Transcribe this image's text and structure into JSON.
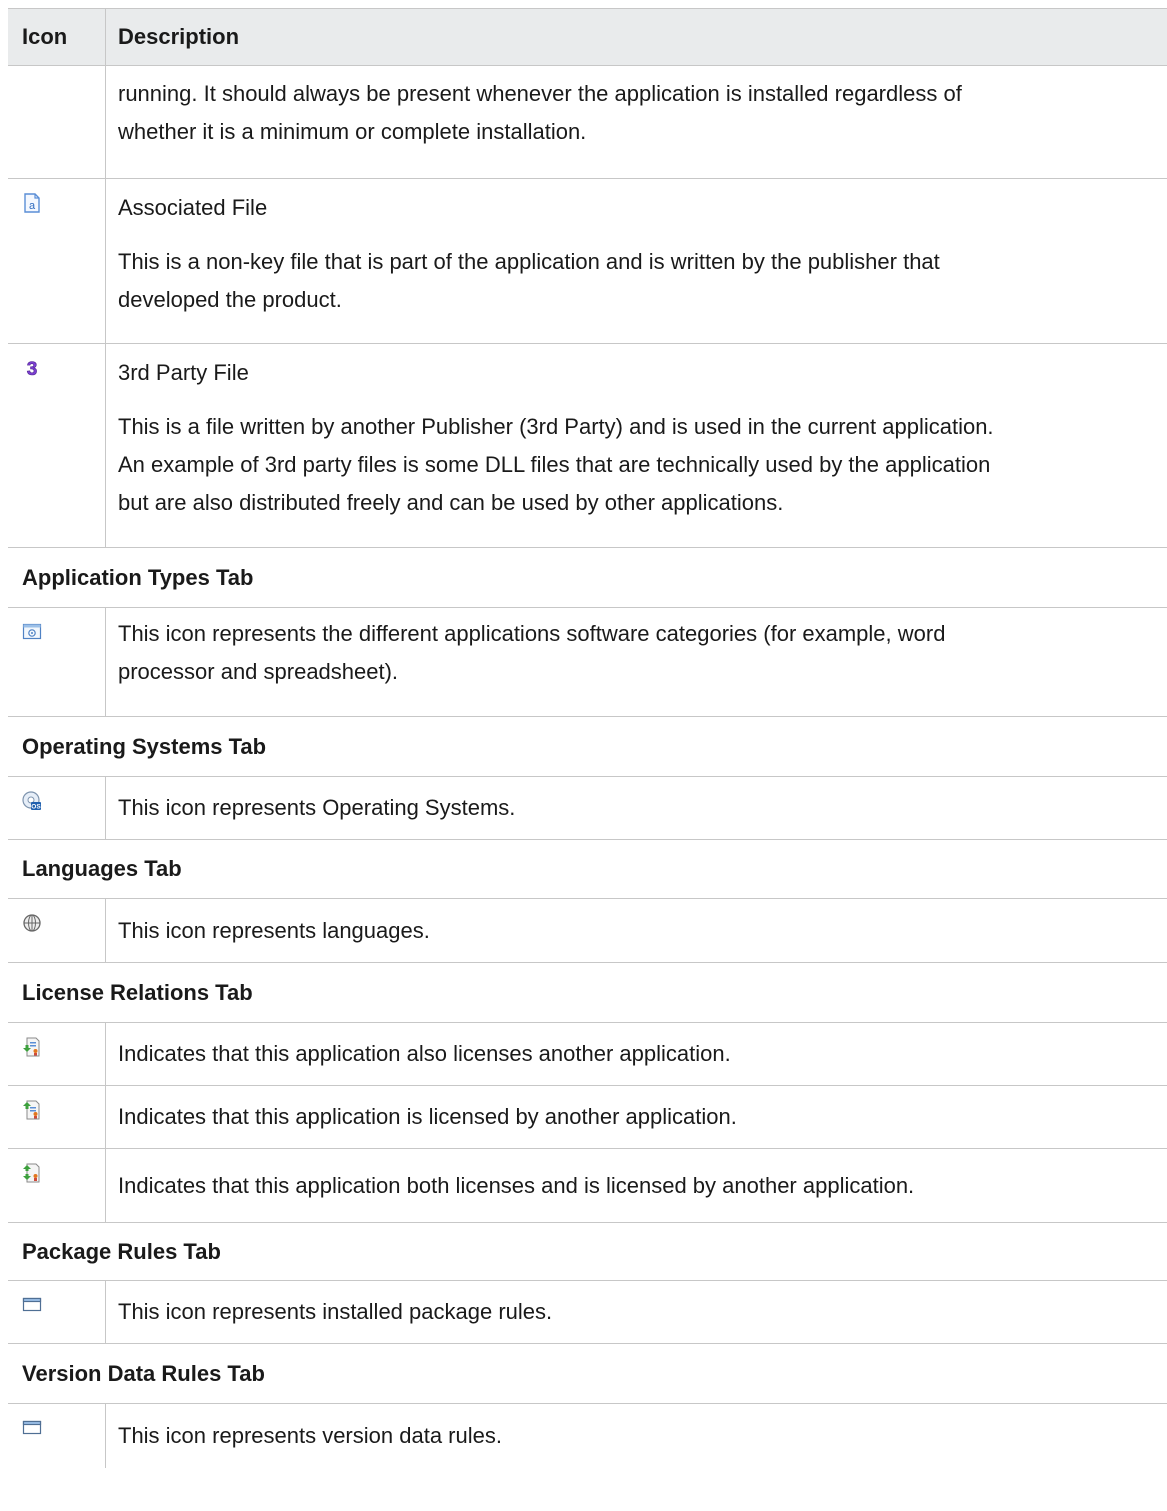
{
  "header": {
    "icon_col": "Icon",
    "desc_col": "Description"
  },
  "rows": [
    {
      "icon": "",
      "paras": [
        "running. It should always be present whenever the application is installed regardless of",
        "whether it is a minimum or complete installation."
      ]
    },
    {
      "icon": "associated-file-icon",
      "title": "Associated File",
      "paras": [
        "This is a non-key file that is part of the application and is written by the publisher that",
        "developed the product."
      ]
    },
    {
      "icon": "third-party-file-icon",
      "title": "3rd Party File",
      "paras": [
        "This is a file written by another Publisher (3rd Party) and is used in the current application.",
        "An example of 3rd party files is some DLL files that are technically used by the application",
        "but are also distributed freely and can be used by other applications."
      ]
    }
  ],
  "sections": {
    "app_types": {
      "title": "Application Types Tab",
      "line1": "This icon represents the different applications software categories (for example, word",
      "line2": "processor and spreadsheet)."
    },
    "os": {
      "title": "Operating Systems Tab",
      "text": "This icon represents Operating Systems."
    },
    "languages": {
      "title": "Languages Tab",
      "text": "This icon represents languages."
    },
    "license": {
      "title": "License Relations Tab",
      "t1": "Indicates that this application also licenses another application.",
      "t2": "Indicates that this application is licensed by another application.",
      "t3": "Indicates that this application both licenses and is licensed by another application."
    },
    "package": {
      "title": "Package Rules Tab",
      "text": "This icon represents installed package rules."
    },
    "version": {
      "title": "Version Data Rules Tab",
      "text": "This icon represents version data rules."
    }
  },
  "colors": {
    "border": "#c7c7c7",
    "header_bg": "#e9ebec",
    "accent_blue": "#2f6bbf",
    "accent_purple": "#7b3fd1"
  }
}
